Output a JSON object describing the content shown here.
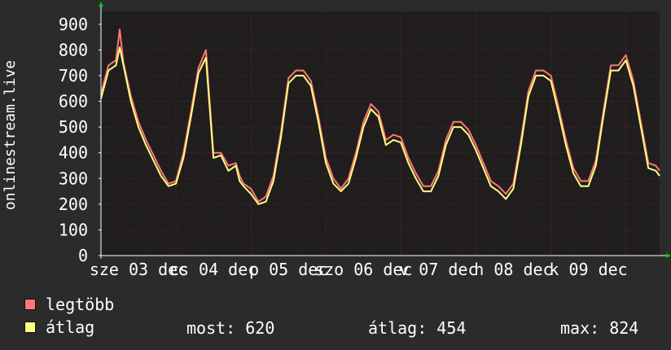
{
  "chart_data": {
    "type": "line",
    "ylabel": "onlinestream.live",
    "ylim": [
      0,
      950
    ],
    "yticks": [
      0,
      100,
      200,
      300,
      400,
      500,
      600,
      700,
      800,
      900
    ],
    "grid": true,
    "xticks": [
      {
        "label": "sze 03 dec",
        "at": 0.5
      },
      {
        "label": "cs 04 dec",
        "at": 1.5
      },
      {
        "label": "p 05 dec",
        "at": 2.5
      },
      {
        "label": "szo 06 dec",
        "at": 3.5
      },
      {
        "label": "v 07 dec",
        "at": 4.5
      },
      {
        "label": "h 08 dec",
        "at": 5.5
      },
      {
        "label": "k 09 dec",
        "at": 6.5
      }
    ],
    "x_unit": "days since 03 dec 00:00",
    "series": [
      {
        "name": "legtöbb",
        "color": "#ff7777",
        "x": [
          0.0,
          0.1,
          0.2,
          0.25,
          0.3,
          0.4,
          0.5,
          0.6,
          0.7,
          0.8,
          0.9,
          1.0,
          1.1,
          1.2,
          1.3,
          1.4,
          1.5,
          1.6,
          1.7,
          1.8,
          1.85,
          1.9,
          2.0,
          2.1,
          2.2,
          2.3,
          2.4,
          2.5,
          2.6,
          2.7,
          2.8,
          2.9,
          3.0,
          3.1,
          3.2,
          3.3,
          3.4,
          3.5,
          3.6,
          3.7,
          3.8,
          3.9,
          4.0,
          4.1,
          4.2,
          4.3,
          4.4,
          4.5,
          4.6,
          4.7,
          4.8,
          4.9,
          5.0,
          5.1,
          5.2,
          5.3,
          5.4,
          5.5,
          5.6,
          5.7,
          5.8,
          5.9,
          6.0,
          6.1,
          6.2,
          6.3,
          6.4,
          6.5,
          6.6,
          6.7,
          6.8,
          6.9,
          7.0,
          7.1,
          7.2,
          7.3,
          7.4,
          7.45
        ],
        "values": [
          630,
          740,
          760,
          880,
          750,
          620,
          520,
          450,
          390,
          330,
          280,
          290,
          400,
          560,
          730,
          800,
          400,
          400,
          350,
          360,
          310,
          280,
          260,
          210,
          230,
          310,
          480,
          690,
          720,
          720,
          680,
          540,
          380,
          300,
          260,
          300,
          400,
          520,
          590,
          560,
          450,
          470,
          460,
          380,
          320,
          270,
          270,
          330,
          450,
          520,
          520,
          490,
          430,
          360,
          290,
          270,
          240,
          280,
          450,
          640,
          720,
          720,
          700,
          580,
          450,
          340,
          290,
          290,
          370,
          560,
          740,
          740,
          780,
          680,
          520,
          360,
          350,
          330
        ]
      },
      {
        "name": "átlag",
        "color": "#ffff80",
        "x": [
          0.0,
          0.1,
          0.2,
          0.25,
          0.3,
          0.4,
          0.5,
          0.6,
          0.7,
          0.8,
          0.9,
          1.0,
          1.1,
          1.2,
          1.3,
          1.4,
          1.5,
          1.6,
          1.7,
          1.8,
          1.85,
          1.9,
          2.0,
          2.1,
          2.2,
          2.3,
          2.4,
          2.5,
          2.6,
          2.7,
          2.8,
          2.9,
          3.0,
          3.1,
          3.2,
          3.3,
          3.4,
          3.5,
          3.6,
          3.7,
          3.8,
          3.9,
          4.0,
          4.1,
          4.2,
          4.3,
          4.4,
          4.5,
          4.6,
          4.7,
          4.8,
          4.9,
          5.0,
          5.1,
          5.2,
          5.3,
          5.4,
          5.5,
          5.6,
          5.7,
          5.8,
          5.9,
          6.0,
          6.1,
          6.2,
          6.3,
          6.4,
          6.5,
          6.6,
          6.7,
          6.8,
          6.9,
          7.0,
          7.1,
          7.2,
          7.3,
          7.4,
          7.45
        ],
        "values": [
          610,
          720,
          740,
          810,
          740,
          600,
          500,
          430,
          370,
          310,
          270,
          280,
          380,
          540,
          710,
          770,
          380,
          390,
          330,
          350,
          290,
          270,
          240,
          200,
          210,
          290,
          460,
          670,
          700,
          700,
          660,
          520,
          360,
          280,
          250,
          280,
          380,
          500,
          570,
          540,
          430,
          450,
          440,
          360,
          300,
          250,
          250,
          310,
          430,
          500,
          500,
          470,
          410,
          340,
          270,
          250,
          220,
          260,
          430,
          620,
          700,
          700,
          680,
          560,
          430,
          320,
          270,
          270,
          350,
          540,
          720,
          720,
          760,
          660,
          500,
          340,
          330,
          310
        ]
      }
    ]
  },
  "legend": {
    "items": [
      {
        "label": "legtöbb",
        "color": "#ff7777"
      },
      {
        "label": "átlag",
        "color": "#ffff80"
      }
    ],
    "stats": {
      "now": "most: 620",
      "avg": "átlag: 454",
      "max": "max: 824"
    }
  },
  "colors": {
    "background": "#2b2b2b",
    "plot_background": "#1e1e1e",
    "grid": "#4a1a1a",
    "axis": "#ffffff",
    "arrow": "#00cc00"
  }
}
